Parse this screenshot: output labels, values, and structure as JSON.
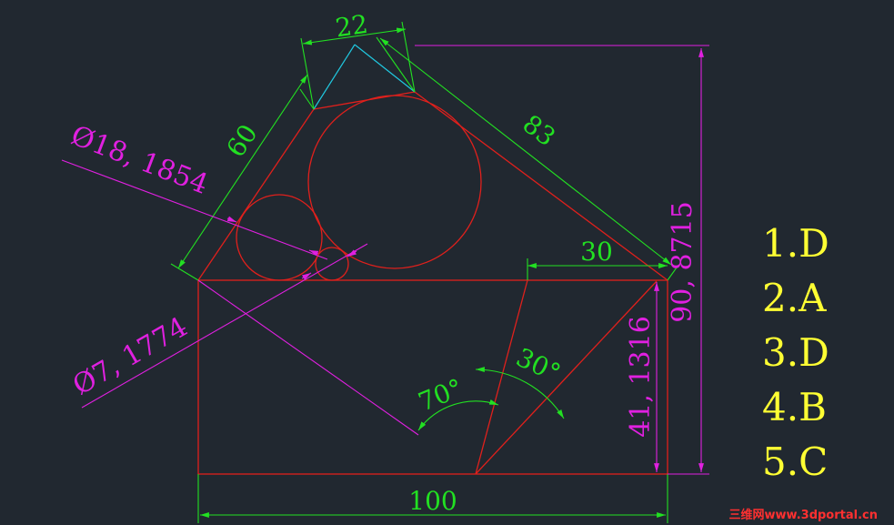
{
  "colors": {
    "background": "#212830",
    "geometry": "#e0201c",
    "dimension": "#22e022",
    "leader": "#e020e0",
    "construction": "#20c8e0",
    "answer": "#ffff33",
    "watermark": "#ff3030"
  },
  "dimensions": {
    "top_width": "22",
    "left_side": "60",
    "right_side": "83",
    "bottom_width": "100",
    "top_right_offset": "30",
    "angle_left": "70°",
    "angle_right": "30°",
    "total_height": "90, 8715",
    "rect_height": "41, 1316",
    "circle_medium": "Ø18, 1854",
    "circle_small": "Ø7, 1774"
  },
  "answers": [
    "1.D",
    "2.A",
    "3.D",
    "4.B",
    "5.C"
  ],
  "watermark": "三维网www.3dportal.cn"
}
